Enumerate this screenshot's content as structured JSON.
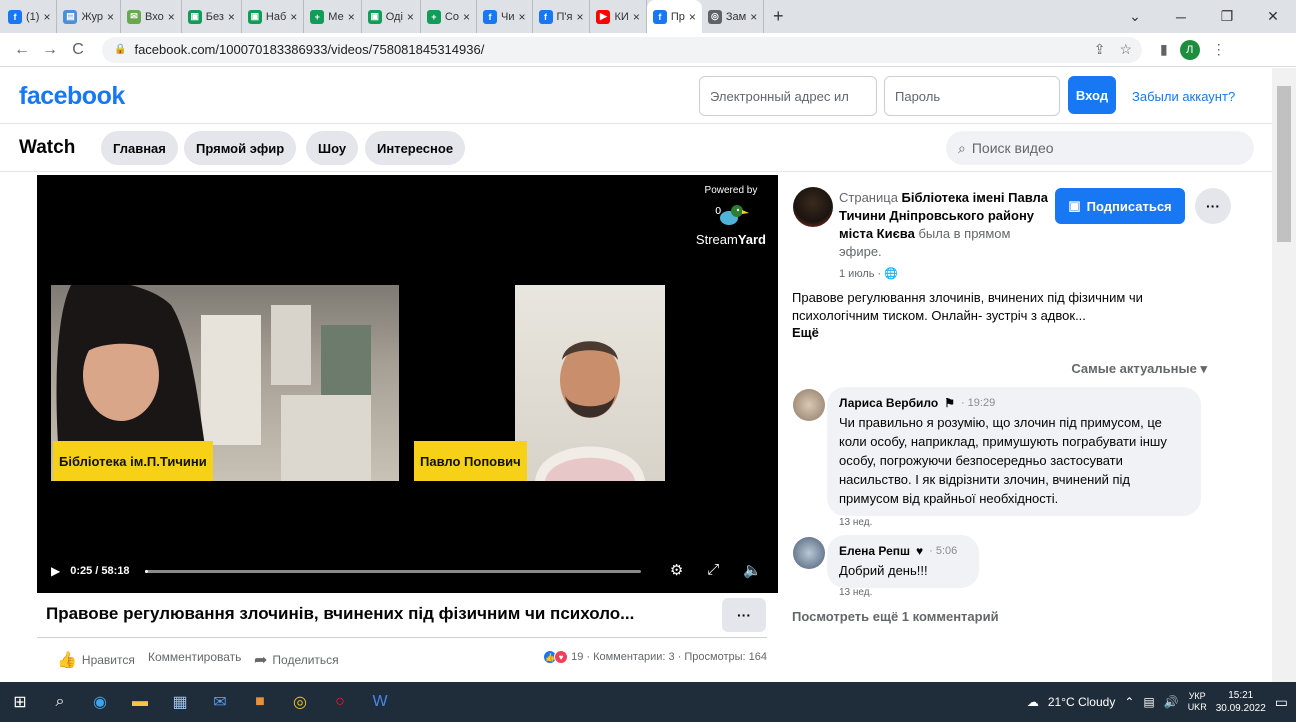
{
  "browser": {
    "tabs": [
      {
        "label": "(1) ",
        "color": "#1877f2",
        "glyph": "f"
      },
      {
        "label": "Жур",
        "color": "#4a90d9",
        "glyph": "▤"
      },
      {
        "label": "Вхо",
        "color": "#6aa84f",
        "glyph": "✉"
      },
      {
        "label": "Без",
        "color": "#0f9d58",
        "glyph": "▣"
      },
      {
        "label": "Наб",
        "color": "#0f9d58",
        "glyph": "▣"
      },
      {
        "label": "Ме",
        "color": "#0f9d58",
        "glyph": "+"
      },
      {
        "label": "Оді",
        "color": "#0f9d58",
        "glyph": "▣"
      },
      {
        "label": "Co",
        "color": "#0f9d58",
        "glyph": "+"
      },
      {
        "label": "Чи",
        "color": "#1877f2",
        "glyph": "f"
      },
      {
        "label": "П'я",
        "color": "#1877f2",
        "glyph": "f"
      },
      {
        "label": "КИ",
        "color": "#ff0000",
        "glyph": "▶"
      },
      {
        "label": "Пр",
        "color": "#1877f2",
        "glyph": "f",
        "active": true
      },
      {
        "label": "Зам",
        "color": "#5f6368",
        "glyph": "◎"
      }
    ],
    "new_tab": "+",
    "url": "facebook.com/100070183386933/videos/758081845314936/",
    "profile_initial": "Л"
  },
  "header": {
    "logo": "facebook",
    "email_placeholder": "Электронный адрес ил",
    "password_placeholder": "Пароль",
    "login_label": "Вход",
    "forgot_label": "Забыли аккаунт?"
  },
  "watch": {
    "title": "Watch",
    "tabs": [
      "Главная",
      "Прямой эфир",
      "Шоу",
      "Интересное"
    ],
    "search_placeholder": "Поиск видео"
  },
  "video": {
    "powered_by": "Powered by",
    "brand_light": "Stream",
    "brand_bold": "Yard",
    "left_name": "Бібліотека ім.П.Тичини",
    "right_name": "Павло Попович",
    "time": "0:25 / 58:18",
    "progress": 0.007,
    "title": "Правове регулювання злочинів, вчинених під фізичним чи психоло...",
    "more": "···"
  },
  "actions": {
    "like": "Нравится",
    "comment": "Комментировать",
    "share": "Поделиться",
    "reaction_count": "19",
    "stats": "· Комментарии: 3 · Просмотры: 164"
  },
  "post": {
    "prefix": "Страница ",
    "page_name": "Бібліотека імені Павла Тичини Дніпровського району міста Києва",
    "suffix": " была в прямом эфире.",
    "date": "1 июль ·",
    "subscribe": "Подписаться",
    "more": "···",
    "description": "Правове регулювання злочинів, вчинених під фізичним чи психологічним тиском. Онлайн- зустріч з адвок...",
    "see_more": "Ещё",
    "sort": "Самые актуальные"
  },
  "comments": [
    {
      "author": "Лариса Вербило",
      "time": "· 19:29",
      "text": "Чи правильно я розумію, що злочин під примусом, це коли особу, наприклад, примушують пограбувати іншу особу, погрожуючи безпосередньо застосувати насильство. І як відрізнити злочин, вчинений під примусом від крайньої необхідності.",
      "ago": "13 нед."
    },
    {
      "author": "Елена Репш",
      "time": "· 5:06",
      "text": "Добрий день!!!",
      "ago": "13 нед."
    }
  ],
  "see_more_comments": "Посмотреть ещё 1 комментарий",
  "taskbar": {
    "weather": "21°C  Cloudy",
    "lang_top": "УКР",
    "lang_bottom": "UKR",
    "time": "15:21",
    "date": "30.09.2022"
  }
}
